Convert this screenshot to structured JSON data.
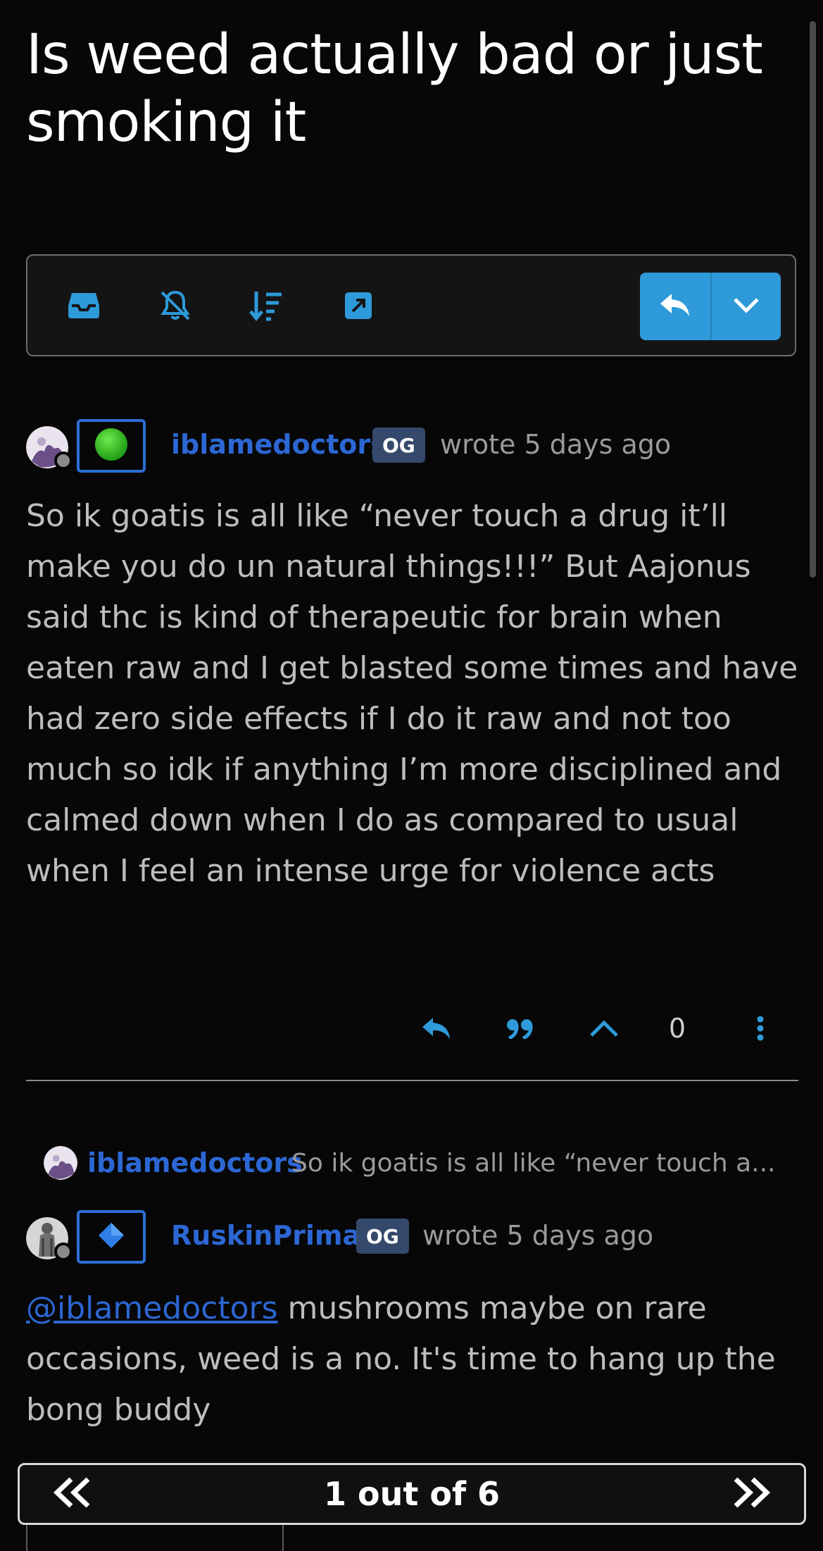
{
  "topic": {
    "title": "Is weed actually bad or just smoking it"
  },
  "toolbar": {
    "icons": [
      "inbox-icon",
      "bell-off-icon",
      "sort-icon",
      "external-link-icon"
    ],
    "reply_icon": "reply-icon",
    "more_icon": "chevron-down-icon",
    "accent": "#2e9ad9"
  },
  "posts": [
    {
      "username": "iblamedoctors",
      "badge": "OG",
      "timestamp": "wrote 5 days ago",
      "flair_icon": "green-circle-icon",
      "body": "So ik goatis is all like “never touch a drug it’ll make you do un natural things!!!” But Aajonus said thc is kind of therapeutic for brain when eaten raw and I get blasted some times and have had zero side effects if I do it raw and not too much so idk if anything I’m more disciplined and calmed down when I do as compared to usual when I feel an intense urge for violence acts",
      "votes": "0"
    },
    {
      "parent_username": "iblamedoctors",
      "parent_snippet": "So ik goatis is all like “never touch a...",
      "username": "RuskinPrimal",
      "badge": "OG",
      "timestamp": "wrote 5 days ago",
      "flair_icon": "blue-diamond-icon",
      "mention": "@iblamedoctors",
      "body": " mushrooms maybe on rare occasions, weed is a no. It's time to hang up the bong buddy"
    }
  ],
  "pager": {
    "label": "1 out of 6"
  },
  "colors": {
    "background": "#070707",
    "link": "#2c67d3",
    "badge": "#34496b"
  }
}
